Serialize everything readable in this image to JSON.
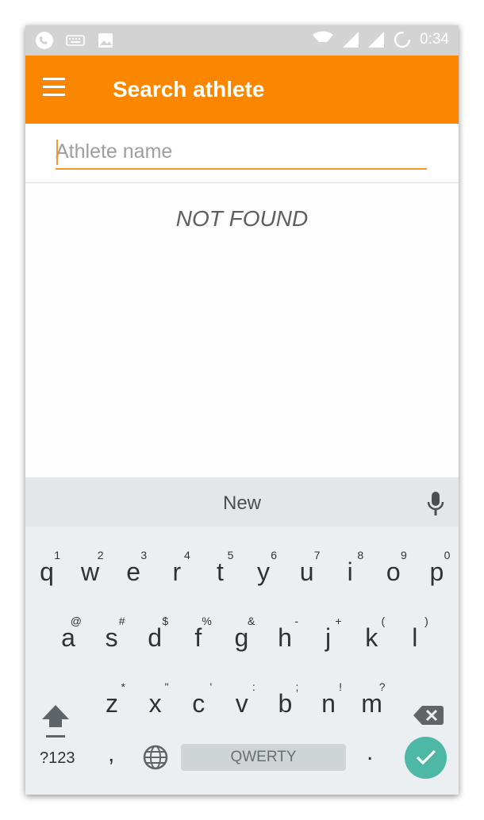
{
  "status_bar": {
    "time": "0:34"
  },
  "app_bar": {
    "title": "Search athlete"
  },
  "search": {
    "placeholder": "Athlete name",
    "value": ""
  },
  "results": {
    "empty_text": "NOT FOUND"
  },
  "keyboard": {
    "suggestion": "New",
    "rows": [
      [
        {
          "k": "q",
          "h": "1"
        },
        {
          "k": "w",
          "h": "2"
        },
        {
          "k": "e",
          "h": "3"
        },
        {
          "k": "r",
          "h": "4"
        },
        {
          "k": "t",
          "h": "5"
        },
        {
          "k": "y",
          "h": "6"
        },
        {
          "k": "u",
          "h": "7"
        },
        {
          "k": "i",
          "h": "8"
        },
        {
          "k": "o",
          "h": "9"
        },
        {
          "k": "p",
          "h": "0"
        }
      ],
      [
        {
          "k": "a",
          "h": "@"
        },
        {
          "k": "s",
          "h": "#"
        },
        {
          "k": "d",
          "h": "$"
        },
        {
          "k": "f",
          "h": "%"
        },
        {
          "k": "g",
          "h": "&"
        },
        {
          "k": "h",
          "h": "-"
        },
        {
          "k": "j",
          "h": "+"
        },
        {
          "k": "k",
          "h": "("
        },
        {
          "k": "l",
          "h": ")"
        }
      ],
      [
        {
          "k": "z",
          "h": "*"
        },
        {
          "k": "x",
          "h": "\""
        },
        {
          "k": "c",
          "h": "'"
        },
        {
          "k": "v",
          "h": ":"
        },
        {
          "k": "b",
          "h": ";"
        },
        {
          "k": "n",
          "h": "!"
        },
        {
          "k": "m",
          "h": "?"
        }
      ]
    ],
    "symbols_label": "?123",
    "comma": ",",
    "space_label": "QWERTY",
    "period": "."
  }
}
